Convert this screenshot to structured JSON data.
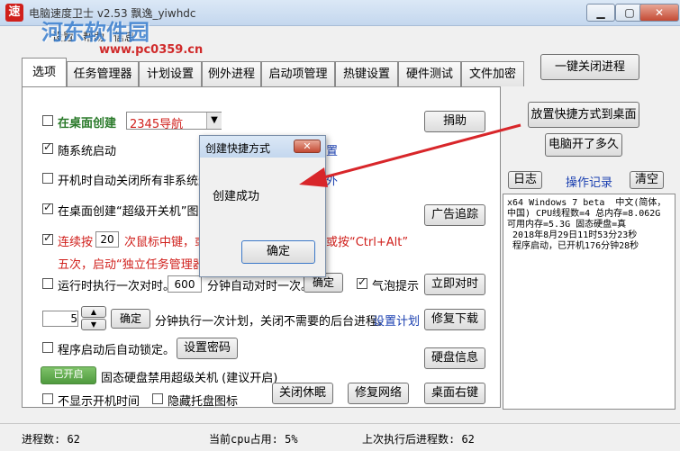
{
  "window": {
    "icon_char": "速",
    "title": "电脑速度卫士 v2.53  飘逸_yiwhdc"
  },
  "watermark": {
    "text": "河东软件园",
    "url": "www.pc0359.cn"
  },
  "menu": [
    "设置",
    "帮助",
    "信息"
  ],
  "tabs": [
    "选项",
    "任务管理器",
    "计划设置",
    "例外进程",
    "启动项管理",
    "热键设置",
    "硬件测试",
    "文件加密"
  ],
  "top_right_button": "一键关闭进程",
  "options": {
    "desktop_create": "在桌面创建",
    "desktop_select": "2345导航",
    "donate": "捐助",
    "autostart": "随系统启动",
    "autostart_suffix": "置",
    "autoclose": "开机时自动关闭所有非系统进",
    "autoclose_suffix": "外",
    "super_switch": "在桌面创建“超级开关机”图",
    "ad_trace": "广告追踪",
    "press_prefix": "连续按",
    "press_count": "20",
    "press_suffix": "次鼠标中键，或按",
    "press_suffix2": "或按“Ctrl+Alt”",
    "press_line2": "五次，启动“独立任务管理器”。",
    "sync_time": "运行时执行一次对时。",
    "sync_value": "600",
    "sync_suffix": "分钟自动对时一次。",
    "sync_confirm": "确定",
    "bubble": "气泡提示",
    "sync_now": "立即对时",
    "plan_value": "5",
    "plan_confirm": "确定",
    "plan_text": "分钟执行一次计划，关闭不需要的后台进程。",
    "plan_link": "设置计划",
    "repair_download": "修复下载",
    "lock_text": "程序启动后自动锁定。",
    "set_password": "设置密码",
    "disk_info": "硬盘信息",
    "ssd_toggle": "已开启",
    "ssd_text": "固态硬盘禁用超级关机 (建议开启)",
    "hide_boot_time": "不显示开机时间",
    "hide_tray": "隐藏托盘图标",
    "close_sleep": "关闭休眠",
    "repair_network": "修复网络",
    "desktop_right": "桌面右键"
  },
  "side": {
    "place_shortcut": "放置快捷方式到桌面",
    "uptime": "电脑开了多久",
    "log_tab": "日志",
    "oplog_tab": "操作记录",
    "clear": "清空",
    "log_text": "x64 Windows 7 beta  中文(简体，中国) CPU线程数=4 总内存=8.062G 可用内存=5.3G 固态硬盘=真\n 2018年8月29日11时53分23秒\n 程序启动，已开机176分钟28秒"
  },
  "dialog": {
    "title": "创建快捷方式",
    "close": "✕",
    "message": "创建成功",
    "ok": "确定"
  },
  "status": {
    "processes": "进程数: 62",
    "cpu": "当前cpu占用: 5%",
    "last": "上次执行后进程数: 62"
  },
  "colors": {
    "accent_red": "#d0201c",
    "link_blue": "#1a3fb0",
    "arrow": "#d8262a"
  }
}
